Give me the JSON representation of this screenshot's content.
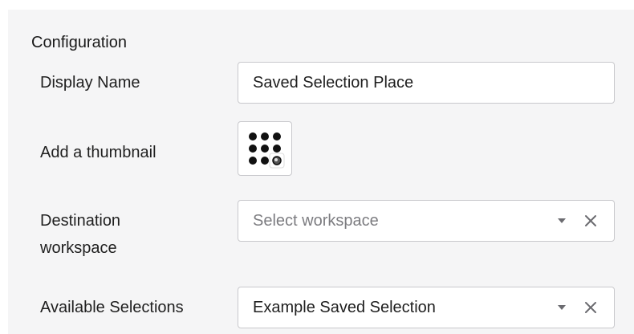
{
  "config": {
    "title": "Configuration",
    "display_name": {
      "label": "Display Name",
      "value": "Saved Selection Place"
    },
    "thumbnail": {
      "label": "Add a thumbnail",
      "icon": "grid-dots-icon"
    },
    "destination": {
      "label_line1": "Destination",
      "label_line2": "workspace",
      "placeholder": "Select workspace"
    },
    "available": {
      "label": "Available Selections",
      "value": "Example Saved Selection"
    }
  }
}
